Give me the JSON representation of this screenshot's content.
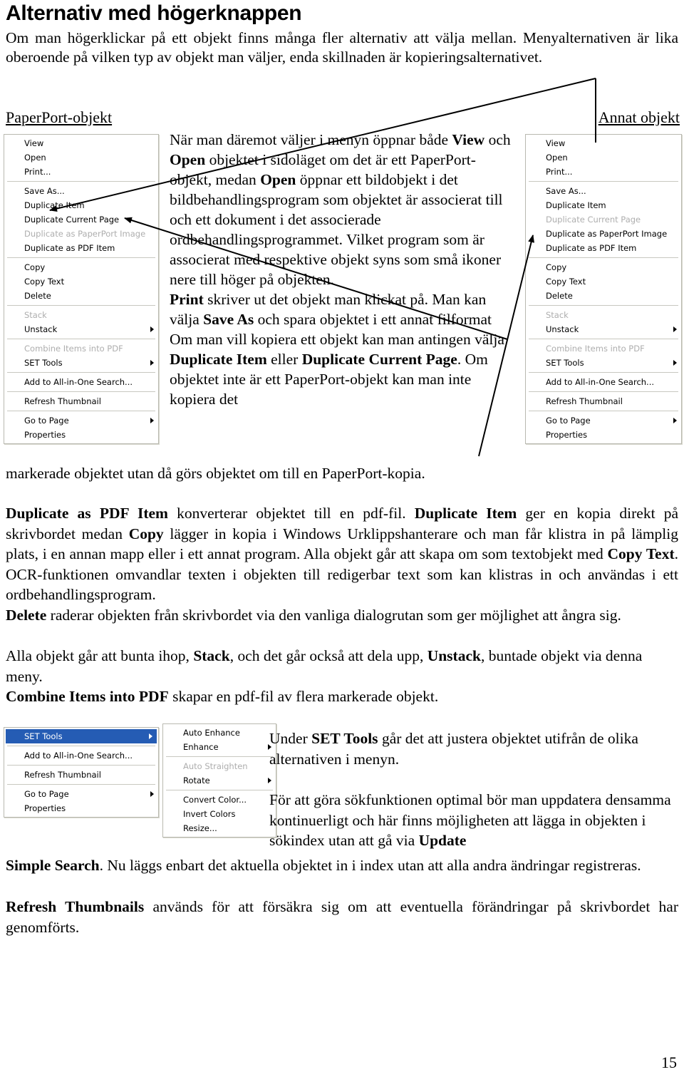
{
  "page": {
    "number": "15",
    "heading": "Alternativ med högerknappen",
    "intro": "Om man högerklickar på ett objekt finns många fler alternativ att välja mellan. Menyalternativen är lika oberoende på vilken typ av objekt man väljer, enda skillnaden är kopieringsalternativet.",
    "label_left": "PaperPort-objekt",
    "label_right": "Annat objekt"
  },
  "middle_text": {
    "p1_a": "När man däremot väljer i menyn öppnar både ",
    "p1_b": "View",
    "p1_c": " och ",
    "p1_d": "Open",
    "p1_e": " objektet i sidoläget om det är ett PaperPort-objekt, medan ",
    "p1_f": "Open",
    "p1_g": " öppnar ett bildobjekt i det bildbehandlingsprogram som objektet är associerat till och ett dokument i det associerade ordbehandlingsprogrammet. Vilket program som är associerat med respektive objekt syns som små ikoner nere till höger på objekten.",
    "p2_a": "Print",
    "p2_b": " skriver ut det objekt man klickat på. Man kan välja ",
    "p2_c": "Save As",
    "p2_d": " och spara objektet i ett annat filformat",
    "p3_a": "Om man vill kopiera ett objekt kan man antingen välja ",
    "p3_b": "Duplicate Item",
    "p3_c": " eller ",
    "p3_d": "Duplicate Current Page",
    "p3_e": ". Om objektet inte är ett PaperPort-objekt kan man inte kopiera det",
    "tail": "markerade objektet utan då görs objektet om till en PaperPort-kopia."
  },
  "body": {
    "para1_a": "Duplicate as PDF Item",
    "para1_b": " konverterar objektet till en pdf-fil. ",
    "para1_c": "Duplicate Item",
    "para1_d": " ger en kopia direkt på skrivbordet medan ",
    "para1_e": "Copy",
    "para1_f": " lägger in kopia i Windows Urklippshanterare och man får klistra in på lämplig plats, i en annan mapp eller i ett annat program. Alla objekt går att skapa om som textobjekt med ",
    "para1_g": "Copy Text",
    "para1_h": ". OCR-funktionen omvandlar texten i objekten till redigerbar text som kan klistras in och användas i ett ordbehandlingsprogram.",
    "para2_a": "Delete",
    "para2_b": " raderar objekten från skrivbordet via den vanliga dialogrutan som ger möjlighet att ångra sig.",
    "para3_a": "Alla objekt går att bunta ihop, ",
    "para3_b": "Stack",
    "para3_c": ", och det går också att dela upp, ",
    "para3_d": "Unstack",
    "para3_e": ", buntade objekt via denna meny.",
    "para4_a": "Combine Items into PDF",
    "para4_b": " skapar en pdf-fil av flera markerade objekt."
  },
  "right_column": {
    "p1_a": "Under ",
    "p1_b": "SET Tools",
    "p1_c": " går det att justera objektet utifrån de olika alternativen i menyn.",
    "p2_a": "För att göra sökfunktionen optimal bör man uppdatera densamma kontinuerligt och här finns möjligheten att lägga in objekten i sökindex utan att gå via ",
    "p2_b": "Update"
  },
  "bottom_text": {
    "p1_a": "Simple Search",
    "p1_b": ". Nu läggs enbart det aktuella objektet in i index utan att alla andra ändringar registreras.",
    "p2_a": "Refresh Thumbnails",
    "p2_b": " används för att försäkra sig om att eventuella förändringar på skrivbordet har genomförts."
  },
  "menu_left": {
    "title": "PaperPort-objekt context menu",
    "items": [
      {
        "label": "View",
        "disabled": false,
        "submenu": false
      },
      {
        "label": "Open",
        "disabled": false,
        "submenu": false
      },
      {
        "label": "Print...",
        "disabled": false,
        "submenu": false
      },
      {
        "separator": true
      },
      {
        "label": "Save As...",
        "disabled": false,
        "submenu": false
      },
      {
        "label": "Duplicate Item",
        "disabled": false,
        "submenu": false
      },
      {
        "label": "Duplicate Current Page",
        "disabled": false,
        "submenu": false
      },
      {
        "label": "Duplicate as PaperPort Image",
        "disabled": true,
        "submenu": false
      },
      {
        "label": "Duplicate as PDF Item",
        "disabled": false,
        "submenu": false
      },
      {
        "separator": true
      },
      {
        "label": "Copy",
        "disabled": false,
        "submenu": false
      },
      {
        "label": "Copy Text",
        "disabled": false,
        "submenu": false
      },
      {
        "label": "Delete",
        "disabled": false,
        "submenu": false
      },
      {
        "separator": true
      },
      {
        "label": "Stack",
        "disabled": true,
        "submenu": false
      },
      {
        "label": "Unstack",
        "disabled": false,
        "submenu": true
      },
      {
        "separator": true
      },
      {
        "label": "Combine Items into PDF",
        "disabled": true,
        "submenu": false
      },
      {
        "label": "SET Tools",
        "disabled": false,
        "submenu": true
      },
      {
        "separator": true
      },
      {
        "label": "Add to All-in-One Search...",
        "disabled": false,
        "submenu": false
      },
      {
        "separator": true
      },
      {
        "label": "Refresh Thumbnail",
        "disabled": false,
        "submenu": false
      },
      {
        "separator": true
      },
      {
        "label": "Go to Page",
        "disabled": false,
        "submenu": true
      },
      {
        "label": "Properties",
        "disabled": false,
        "submenu": false
      }
    ]
  },
  "menu_right": {
    "title": "Annat objekt context menu",
    "items": [
      {
        "label": "View",
        "disabled": false,
        "submenu": false
      },
      {
        "label": "Open",
        "disabled": false,
        "submenu": false
      },
      {
        "label": "Print...",
        "disabled": false,
        "submenu": false
      },
      {
        "separator": true
      },
      {
        "label": "Save As...",
        "disabled": false,
        "submenu": false
      },
      {
        "label": "Duplicate Item",
        "disabled": false,
        "submenu": false
      },
      {
        "label": "Duplicate Current Page",
        "disabled": true,
        "submenu": false
      },
      {
        "label": "Duplicate as PaperPort Image",
        "disabled": false,
        "submenu": false
      },
      {
        "label": "Duplicate as PDF Item",
        "disabled": false,
        "submenu": false
      },
      {
        "separator": true
      },
      {
        "label": "Copy",
        "disabled": false,
        "submenu": false
      },
      {
        "label": "Copy Text",
        "disabled": false,
        "submenu": false
      },
      {
        "label": "Delete",
        "disabled": false,
        "submenu": false
      },
      {
        "separator": true
      },
      {
        "label": "Stack",
        "disabled": true,
        "submenu": false
      },
      {
        "label": "Unstack",
        "disabled": false,
        "submenu": true
      },
      {
        "separator": true
      },
      {
        "label": "Combine Items into PDF",
        "disabled": true,
        "submenu": false
      },
      {
        "label": "SET Tools",
        "disabled": false,
        "submenu": true
      },
      {
        "separator": true
      },
      {
        "label": "Add to All-in-One Search...",
        "disabled": false,
        "submenu": false
      },
      {
        "separator": true
      },
      {
        "label": "Refresh Thumbnail",
        "disabled": false,
        "submenu": false
      },
      {
        "separator": true
      },
      {
        "label": "Go to Page",
        "disabled": false,
        "submenu": true
      },
      {
        "label": "Properties",
        "disabled": false,
        "submenu": false
      }
    ]
  },
  "menu_bottom": {
    "title": "SET Tools parent menu",
    "items": [
      {
        "label": "SET Tools",
        "disabled": false,
        "submenu": true,
        "selected": true
      },
      {
        "separator": true
      },
      {
        "label": "Add to All-in-One Search...",
        "disabled": false,
        "submenu": false
      },
      {
        "separator": true
      },
      {
        "label": "Refresh Thumbnail",
        "disabled": false,
        "submenu": false
      },
      {
        "separator": true
      },
      {
        "label": "Go to Page",
        "disabled": false,
        "submenu": true
      },
      {
        "label": "Properties",
        "disabled": false,
        "submenu": false
      }
    ]
  },
  "menu_set_tools": {
    "title": "SET Tools submenu",
    "items": [
      {
        "label": "Auto Enhance",
        "disabled": false,
        "submenu": false
      },
      {
        "label": "Enhance",
        "disabled": false,
        "submenu": true
      },
      {
        "separator": true
      },
      {
        "label": "Auto Straighten",
        "disabled": true,
        "submenu": false
      },
      {
        "label": "Rotate",
        "disabled": false,
        "submenu": true
      },
      {
        "separator": true
      },
      {
        "label": "Convert Color...",
        "disabled": false,
        "submenu": false
      },
      {
        "label": "Invert Colors",
        "disabled": false,
        "submenu": false
      },
      {
        "label": "Resize...",
        "disabled": false,
        "submenu": false
      }
    ]
  },
  "colors": {
    "menu_highlight": "#255cb4",
    "menu_border": "#b9b9b0",
    "menu_disabled_text": "#aeaeae",
    "page_background": "#ffffff",
    "text": "#000000"
  }
}
